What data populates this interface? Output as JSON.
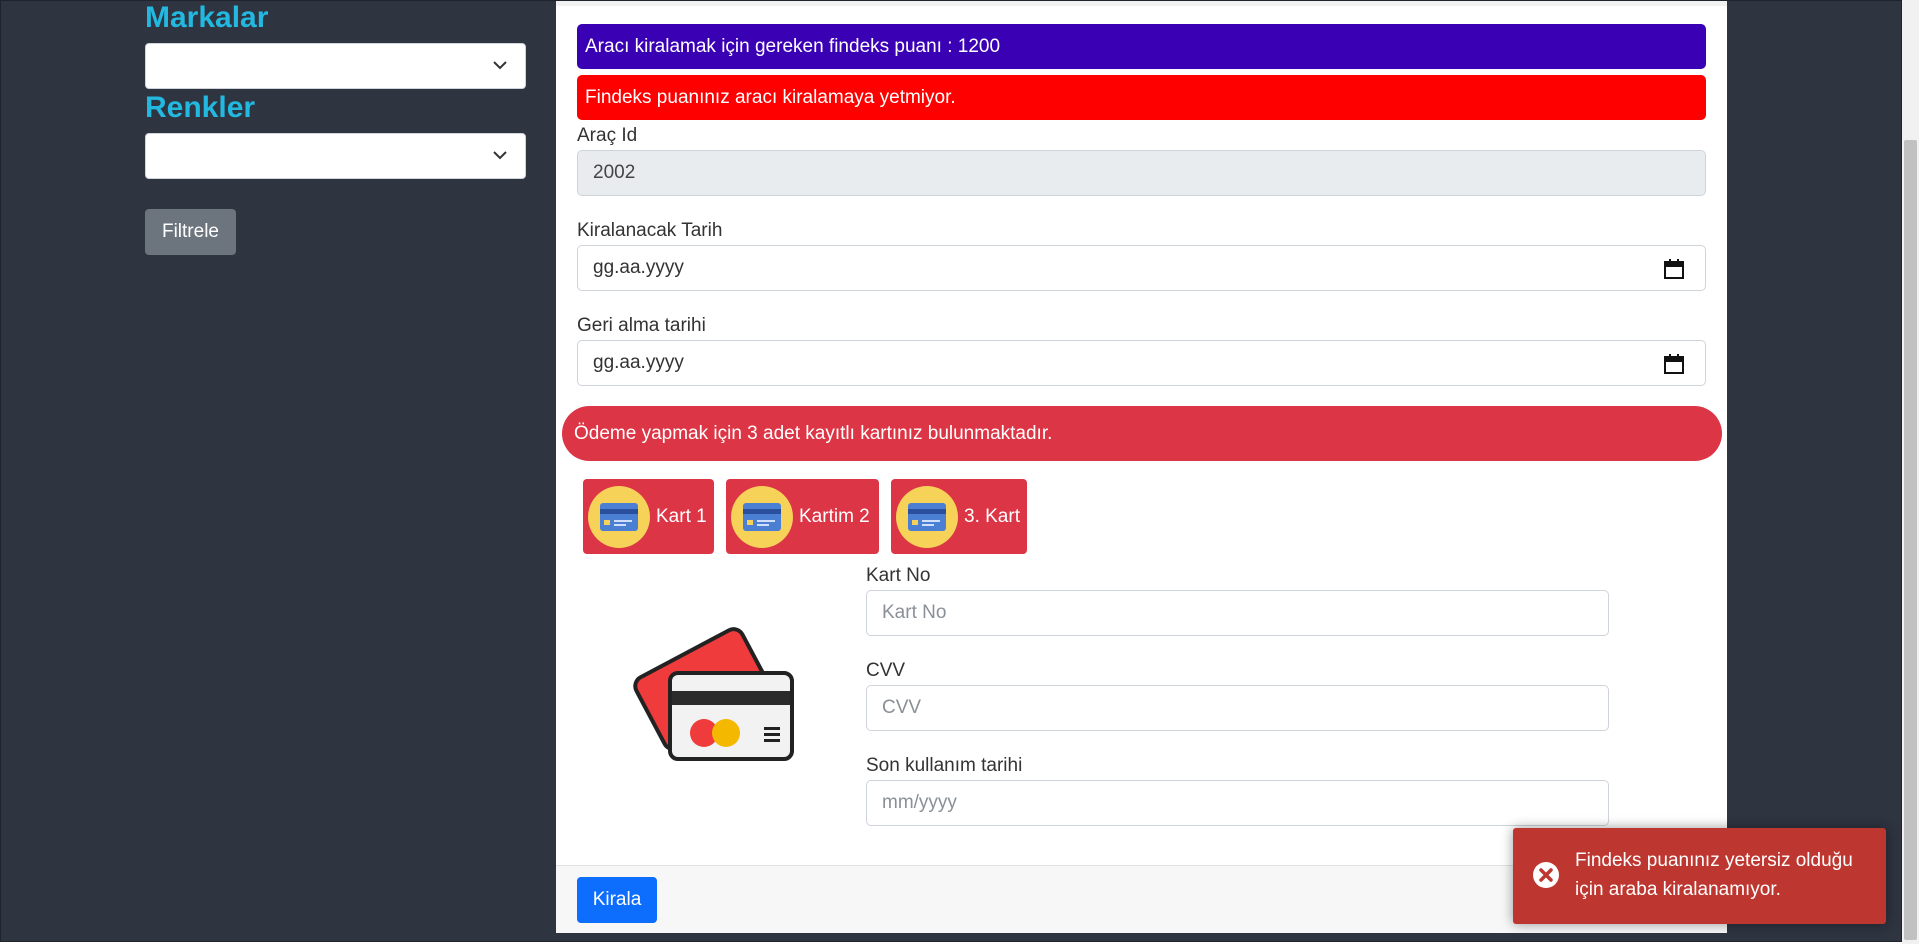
{
  "sidebar": {
    "brands_title": "Markalar",
    "colors_title": "Renkler",
    "filter_label": "Filtrele"
  },
  "alerts": {
    "findeks_required": "Aracı kiralamak için gereken findeks puanı : 1200",
    "findeks_insufficient": "Findeks puanınız aracı kiralamaya yetmiyor."
  },
  "form": {
    "car_id_label": "Araç Id",
    "car_id_value": "2002",
    "rent_date_label": "Kiralanacak Tarih",
    "rent_date_value": "gg.aa.yyyy",
    "return_date_label": "Geri alma tarihi",
    "return_date_value": "gg.aa.yyyy"
  },
  "payment": {
    "saved_cards_alert": "Ödeme yapmak için 3 adet kayıtlı kartınız bulunmaktadır.",
    "cards": [
      {
        "label": "Kart 1"
      },
      {
        "label": "Kartim 2"
      },
      {
        "label": "3. Kart"
      }
    ],
    "card_no_label": "Kart No",
    "card_no_placeholder": "Kart No",
    "cvv_label": "CVV",
    "cvv_placeholder": "CVV",
    "expiry_label": "Son kullanım tarihi",
    "expiry_placeholder": "mm/yyyy"
  },
  "footer": {
    "rent_label": "Kirala"
  },
  "toast": {
    "message": "Findeks puanınız yetersiz olduğu için araba kiralanamıyor."
  },
  "colors": {
    "accent_title": "#22b8e0",
    "alert_primary": "#3a00b4",
    "alert_red": "#ff0000",
    "danger": "#dc3545",
    "toast": "#bd362f",
    "primary_button": "#0d6efd"
  }
}
